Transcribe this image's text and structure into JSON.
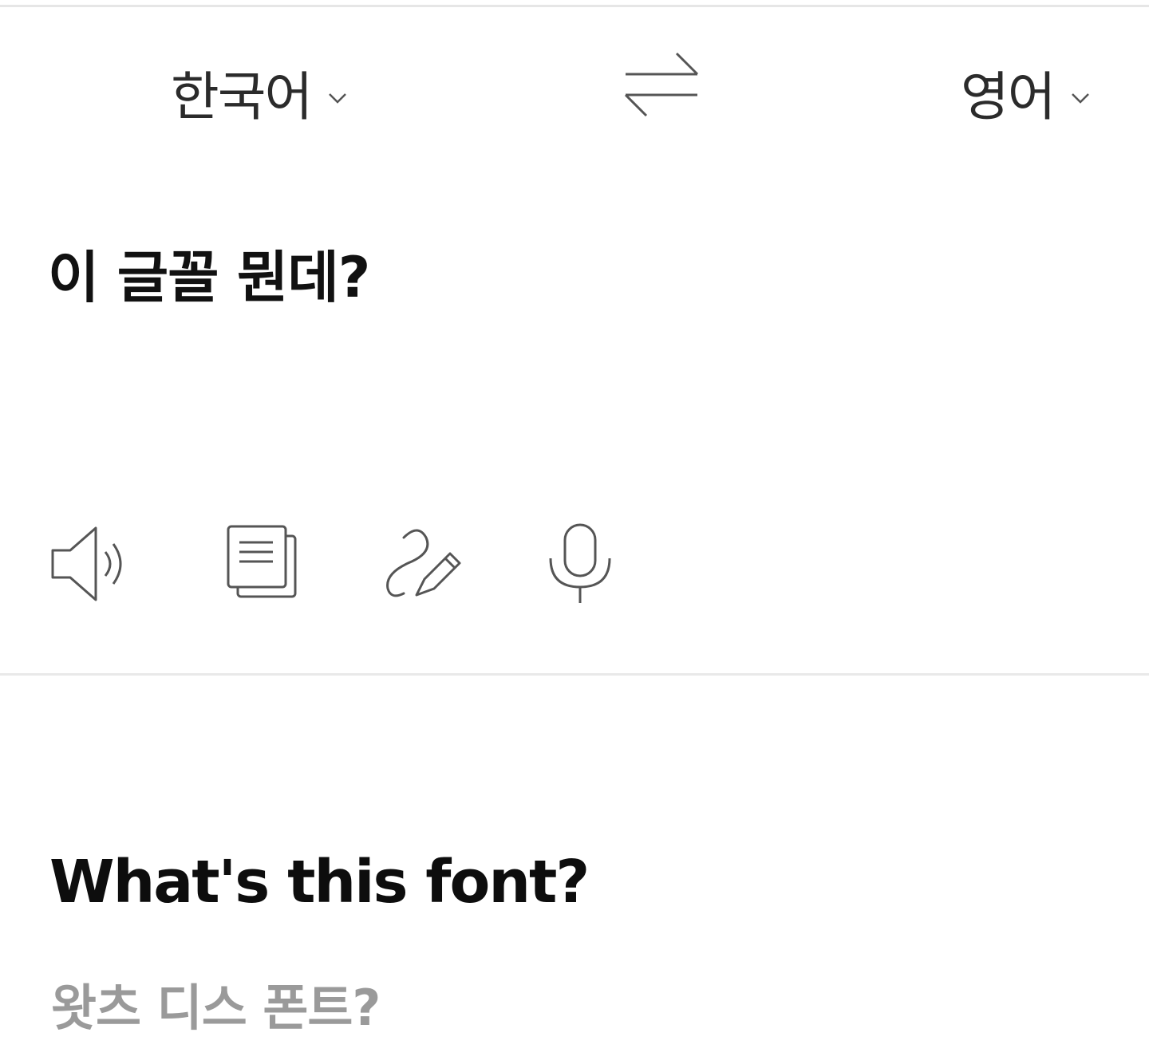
{
  "header": {
    "source_language": "한국어",
    "target_language": "영어"
  },
  "source": {
    "text": "이 글꼴 뭔데?"
  },
  "tools": {
    "icons": [
      "speaker-icon",
      "copy-icon",
      "handwriting-icon",
      "microphone-icon"
    ]
  },
  "result": {
    "translation": "What's this font?",
    "pronunciation": "왓츠 디스 폰트?"
  },
  "colors": {
    "text": "#111111",
    "icon": "#555555",
    "muted": "#9a9a9a",
    "divider": "#e9e9e9"
  }
}
